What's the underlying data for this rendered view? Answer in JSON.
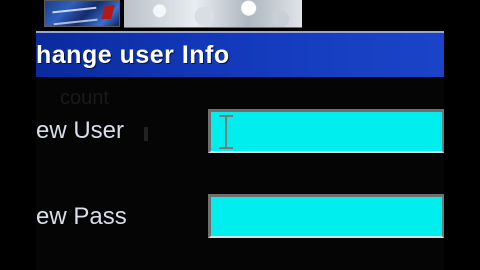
{
  "window": {
    "title": "hange user Info"
  },
  "form": {
    "ghost_label": "count",
    "user_label": "ew User",
    "user_value": "",
    "pass_label": "ew Pass",
    "pass_value": ""
  },
  "colors": {
    "titlebar": "#1238b8",
    "field_bg": "#00eeee",
    "label_text": "#d8dde8",
    "panel_bg": "#050505"
  },
  "icons": {
    "text_cursor": "i-beam-cursor-icon"
  }
}
